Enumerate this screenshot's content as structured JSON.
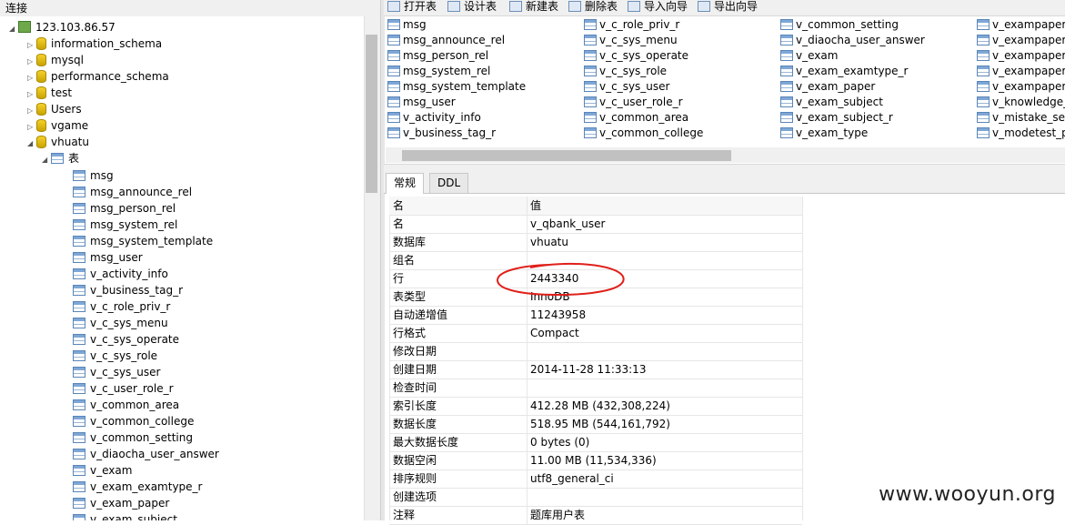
{
  "left": {
    "header": "连接",
    "server": "123.103.86.57",
    "databases": [
      "information_schema",
      "mysql",
      "performance_schema",
      "test",
      "Users",
      "vgame",
      "vhuatu"
    ],
    "tables_folder": "表",
    "tables": [
      "msg",
      "msg_announce_rel",
      "msg_person_rel",
      "msg_system_rel",
      "msg_system_template",
      "msg_user",
      "v_activity_info",
      "v_business_tag_r",
      "v_c_role_priv_r",
      "v_c_sys_menu",
      "v_c_sys_operate",
      "v_c_sys_role",
      "v_c_sys_user",
      "v_c_user_role_r",
      "v_common_area",
      "v_common_college",
      "v_common_setting",
      "v_diaocha_user_answer",
      "v_exam",
      "v_exam_examtype_r",
      "v_exam_paper",
      "v_exam_subject"
    ]
  },
  "toolbar": {
    "open": "打开表",
    "design": "设计表",
    "new": "新建表",
    "delete": "删除表",
    "import": "导入向导",
    "export": "导出向导"
  },
  "objects": {
    "col1": [
      "msg",
      "msg_announce_rel",
      "msg_person_rel",
      "msg_system_rel",
      "msg_system_template",
      "msg_user",
      "v_activity_info",
      "v_business_tag_r"
    ],
    "col2": [
      "v_c_role_priv_r",
      "v_c_sys_menu",
      "v_c_sys_operate",
      "v_c_sys_role",
      "v_c_sys_user",
      "v_c_user_role_r",
      "v_common_area",
      "v_common_college"
    ],
    "col3": [
      "v_common_setting",
      "v_diaocha_user_answer",
      "v_exam",
      "v_exam_examtype_r",
      "v_exam_paper",
      "v_exam_subject",
      "v_exam_subject_r",
      "v_exam_type"
    ],
    "col4": [
      "v_exampaper_",
      "v_exampaper_",
      "v_exampaper_",
      "v_exampaper_",
      "v_exampaper_",
      "v_knowledge_",
      "v_mistake_set",
      "v_modetest_p"
    ]
  },
  "tabs": [
    "常规",
    "DDL"
  ],
  "props": {
    "header": {
      "k": "名",
      "v": "值"
    },
    "rows": [
      {
        "k": "名",
        "v": "v_qbank_user"
      },
      {
        "k": "数据库",
        "v": "vhuatu"
      },
      {
        "k": "组名",
        "v": ""
      },
      {
        "k": "行",
        "v": "2443340"
      },
      {
        "k": "表类型",
        "v": "InnoDB"
      },
      {
        "k": "自动递增值",
        "v": "11243958"
      },
      {
        "k": "行格式",
        "v": "Compact"
      },
      {
        "k": "修改日期",
        "v": ""
      },
      {
        "k": "创建日期",
        "v": "2014-11-28 11:33:13"
      },
      {
        "k": "检查时间",
        "v": ""
      },
      {
        "k": "索引长度",
        "v": "412.28 MB (432,308,224)"
      },
      {
        "k": "数据长度",
        "v": "518.95 MB (544,161,792)"
      },
      {
        "k": "最大数据长度",
        "v": "0 bytes (0)"
      },
      {
        "k": "数据空闲",
        "v": "11.00 MB (11,534,336)"
      },
      {
        "k": "排序规则",
        "v": "utf8_general_ci"
      },
      {
        "k": "创建选项",
        "v": ""
      },
      {
        "k": "注释",
        "v": "题库用户表"
      }
    ]
  },
  "watermark": "www.wooyun.org",
  "colors": {
    "annotation_red": "#e0201b",
    "db_icon": "#f0c419",
    "selection": "#cce8ff"
  }
}
